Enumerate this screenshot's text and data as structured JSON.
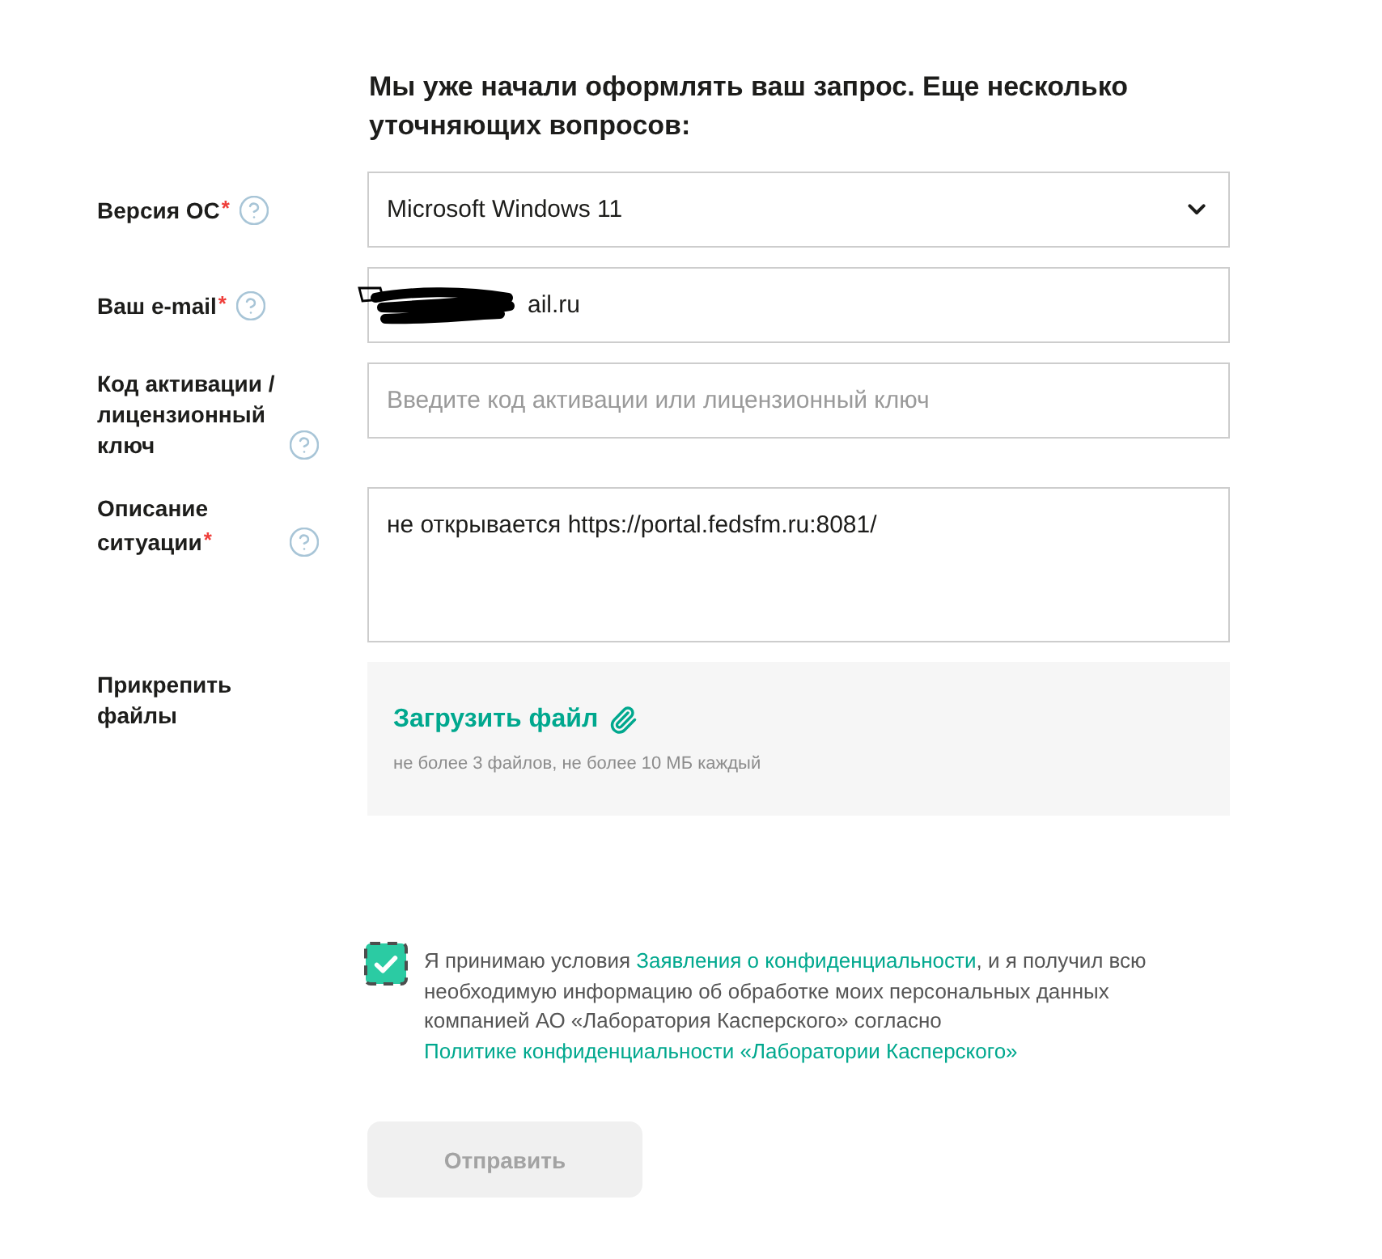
{
  "heading": "Мы уже начали оформлять ваш запрос. Еще несколько уточняющих вопросов:",
  "fields": [
    {
      "kind": "select",
      "label": "Версия ОС",
      "required_mark": "*",
      "help": true,
      "value": "Microsoft Windows 11"
    },
    {
      "kind": "text",
      "label": "Ваш e-mail",
      "required_mark": "*",
      "help": true,
      "value": "ail.ru",
      "redacted": true
    },
    {
      "kind": "text",
      "label": "Код активации / лицензионный ключ",
      "help": true,
      "placeholder": "Введите код активации или лицензионный ключ"
    },
    {
      "kind": "textarea",
      "label": "Описание ситуации",
      "required_mark": "*",
      "help": true,
      "value": "не открывается https://portal.fedsfm.ru:8081/"
    },
    {
      "kind": "upload",
      "label": "Прикрепить файлы",
      "link": "Загрузить файл",
      "hint": "не более 3 файлов, не более 10 МБ каждый"
    }
  ],
  "consent": {
    "checked": true,
    "parts": [
      {
        "kind": "text",
        "text": "Я принимаю условия "
      },
      {
        "kind": "link",
        "text": "Заявления о конфиденциальности"
      },
      {
        "kind": "text",
        "text": ", и я получил всю необходимую информацию об обработке моих персональных данных компанией АО «Лаборатория Касперского» согласно "
      },
      {
        "kind": "link",
        "text": "Политике конфиденциальности «Лаборатории Касперского»"
      }
    ]
  },
  "submit": {
    "label": "Отправить",
    "disabled": true
  }
}
